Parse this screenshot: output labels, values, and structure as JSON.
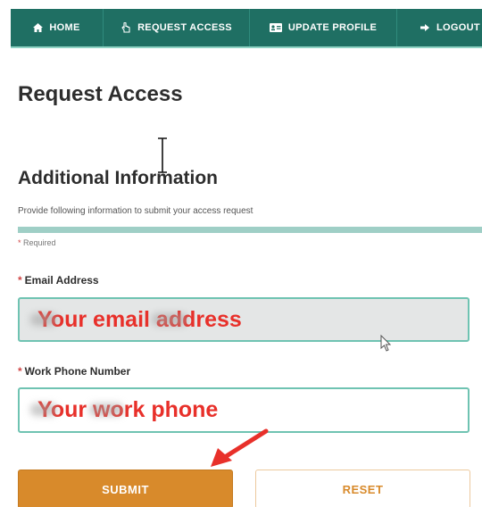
{
  "nav": {
    "items": [
      {
        "label": "HOME",
        "icon": "home-icon"
      },
      {
        "label": "REQUEST ACCESS",
        "icon": "hand-pointer-icon"
      },
      {
        "label": "UPDATE PROFILE",
        "icon": "id-card-icon"
      },
      {
        "label": "LOGOUT",
        "icon": "sign-out-icon"
      }
    ]
  },
  "page": {
    "title": "Request Access"
  },
  "section": {
    "title": "Additional Information",
    "description": "Provide following information to submit your access request",
    "required_note": "Required"
  },
  "fields": {
    "email": {
      "label": "Email Address",
      "placeholder": "Your email address"
    },
    "phone": {
      "label": "Work Phone Number",
      "placeholder": "Your work phone"
    }
  },
  "buttons": {
    "submit": "SUBMIT",
    "reset": "RESET"
  },
  "colors": {
    "nav_bg": "#1f6f63",
    "accent_teal": "#6fc3b2",
    "submit_orange": "#d88a2b",
    "annotation_red": "#e8302a",
    "required_star": "#d04545"
  }
}
